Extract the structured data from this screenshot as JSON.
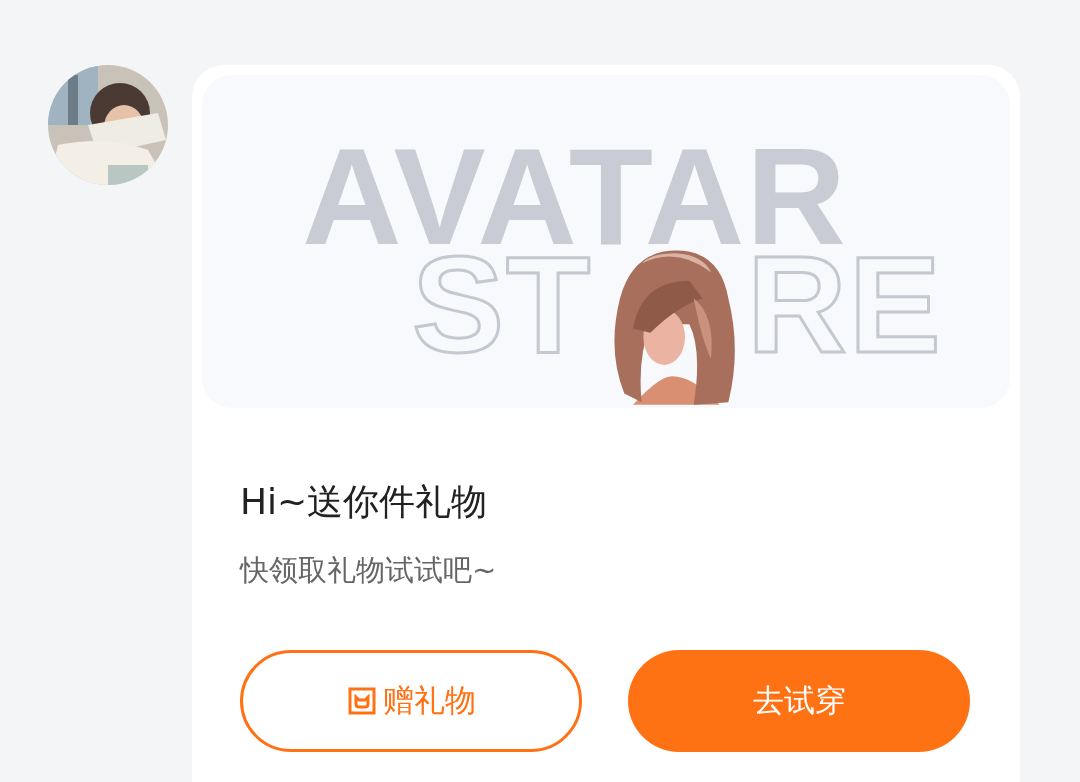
{
  "message": {
    "backdrop_text": [
      "AVATAR",
      "ST",
      "RE"
    ],
    "title": "Hi~送你件礼物",
    "subtitle": "快领取礼物试试吧~",
    "buttons": [
      {
        "kind": "outline",
        "label": "赠礼物"
      },
      {
        "kind": "primary",
        "label": "去试穿"
      }
    ]
  }
}
